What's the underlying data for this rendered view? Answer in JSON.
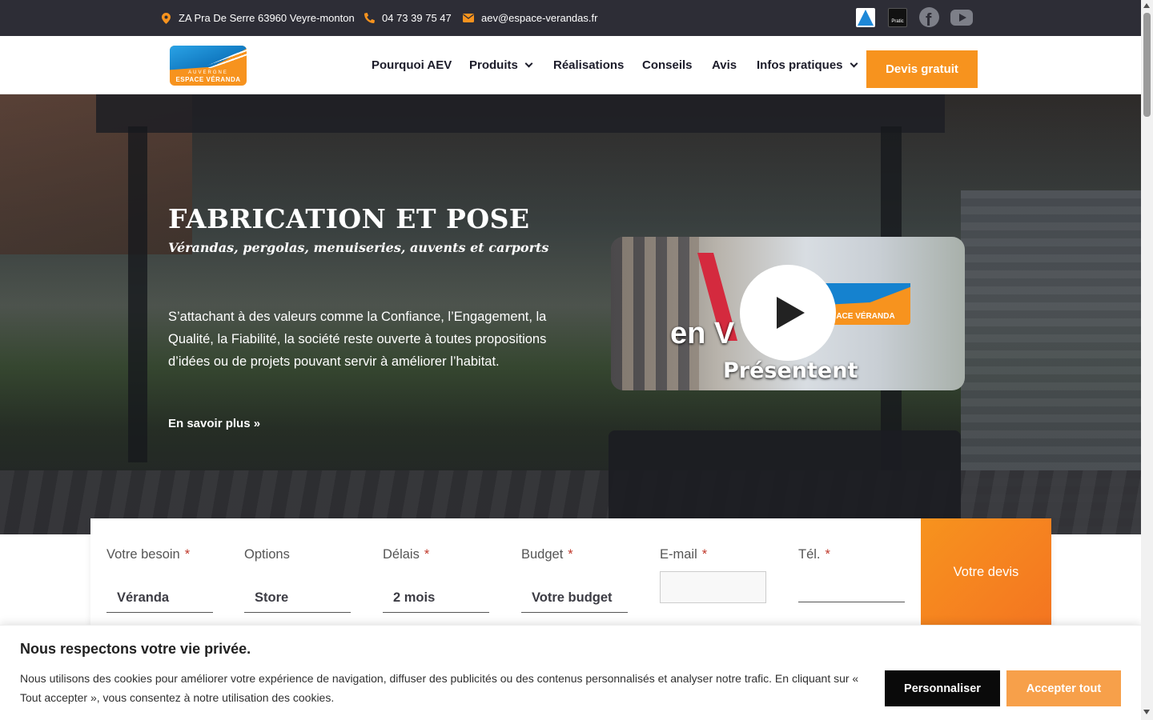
{
  "topbar": {
    "address": "ZA Pra De Serre 63960 Veyre-monton",
    "phone": "04 73 39 75 47",
    "email": "aev@espace-verandas.fr",
    "badge_pratic": "Pratic",
    "icons": {
      "address": "map-marker-icon",
      "phone": "phone-icon",
      "email": "envelope-icon",
      "social": [
        "facebook-icon",
        "youtube-icon"
      ]
    }
  },
  "logo": {
    "line1": "AUVERGNE",
    "line2": "ESPACE VÉRANDA"
  },
  "nav": {
    "items": [
      "Pourquoi AEV",
      "Produits",
      "Réalisations",
      "Conseils",
      "Avis",
      "Infos pratiques"
    ],
    "cta": "Devis gratuit"
  },
  "hero": {
    "title": "FABRICATION ET POSE",
    "subtitle": "Vérandas, pergolas, menuiseries, auvents et carports",
    "text": "S’attachant à des valeurs comme la Confiance, l’Engagement, la Qualité, la Fiabilité, la société reste ouverte à toutes propositions d’idées ou de projets pouvant servir à améliorer l’habitat.",
    "link": "En savoir plus »",
    "video": {
      "logo_text": "ACE VÉRANDA",
      "overlay_en": "en V",
      "overlay_caption": "Présentent"
    }
  },
  "form": {
    "fields": [
      {
        "label": "Votre besoin",
        "required": true,
        "value": "Véranda"
      },
      {
        "label": "Options",
        "required": false,
        "value": "Store"
      },
      {
        "label": "Délais",
        "required": true,
        "value": "2 mois"
      },
      {
        "label": "Budget",
        "required": true,
        "value": "Votre budget"
      },
      {
        "label": "E-mail",
        "required": true,
        "value": ""
      },
      {
        "label": "Tél.",
        "required": true,
        "value": ""
      }
    ],
    "required_mark": "*",
    "submit": "Votre devis"
  },
  "cookie": {
    "title": "Nous respectons votre vie privée.",
    "text": "Nous utilisons des cookies pour améliorer votre expérience de navigation, diffuser des publicités ou des contenus personnalisés et analyser notre trafic. En cliquant sur « Tout accepter », vous consentez à notre utilisation des cookies.",
    "btn_customize": "Personnaliser",
    "btn_accept": "Accepter tout"
  },
  "colors": {
    "accent": "#f7931e",
    "topbar_bg": "#2d2d36",
    "nav_text": "#1c1c2a"
  }
}
